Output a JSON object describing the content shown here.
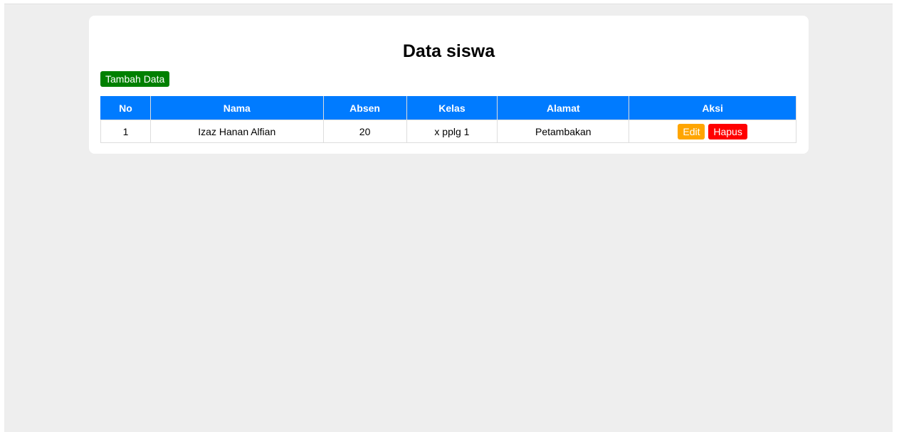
{
  "page": {
    "title": "Data siswa",
    "add_button_label": "Tambah Data"
  },
  "table": {
    "headers": [
      "No",
      "Nama",
      "Absen",
      "Kelas",
      "Alamat",
      "Aksi"
    ],
    "rows": [
      {
        "no": "1",
        "nama": "Izaz Hanan Alfian",
        "absen": "20",
        "kelas": "x pplg 1",
        "alamat": "Petambakan",
        "actions": {
          "edit_label": "Edit",
          "delete_label": "Hapus"
        }
      }
    ]
  },
  "colors": {
    "background": "#eeeeee",
    "card": "#ffffff",
    "header": "#007bff",
    "add_button": "#008000",
    "edit_button": "#ffa500",
    "delete_button": "#ff0000"
  }
}
